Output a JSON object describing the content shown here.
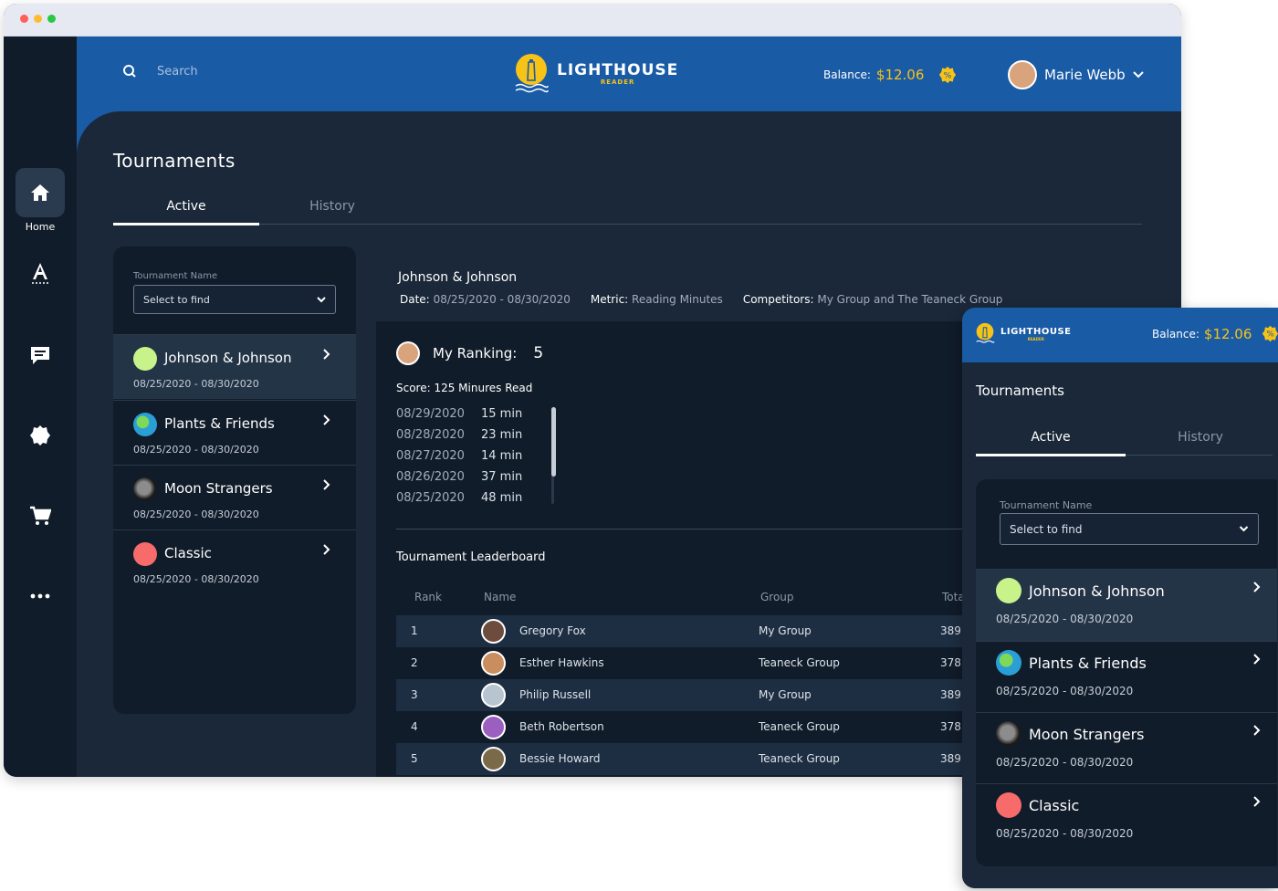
{
  "app": {
    "logo_title": "LIGHTHOUSE",
    "logo_subtitle": "READER",
    "search_placeholder": "Search",
    "balance_label": "Balance:",
    "balance_value": "$12.06",
    "user_name": "Marie Webb",
    "accent": "#1a5ba6",
    "gold": "#f7c316"
  },
  "sidebar": {
    "items": [
      {
        "label": "Home",
        "icon": "home-icon",
        "active": true
      },
      {
        "icon": "reading-icon"
      },
      {
        "icon": "messages-icon"
      },
      {
        "icon": "badge-icon"
      },
      {
        "icon": "cart-icon"
      },
      {
        "icon": "more-icon"
      }
    ]
  },
  "page": {
    "title": "Tournaments",
    "tabs": [
      {
        "label": "Active",
        "active": true
      },
      {
        "label": "History",
        "active": false
      }
    ]
  },
  "filter": {
    "label": "Tournament Name",
    "placeholder": "Select to find"
  },
  "tournaments": [
    {
      "name": "Johnson & Johnson",
      "dates": "08/25/2020 - 08/30/2020",
      "color": "#c8f28a",
      "selected": true
    },
    {
      "name": "Plants & Friends",
      "dates": "08/25/2020 - 08/30/2020",
      "color": "#2a9fd6",
      "selected": false
    },
    {
      "name": "Moon Strangers",
      "dates": "08/25/2020 - 08/30/2020",
      "color": "#3a3a3a",
      "selected": false
    },
    {
      "name": "Classic",
      "dates": "08/25/2020 - 08/30/2020",
      "color": "#f76b6b",
      "selected": false
    }
  ],
  "detail": {
    "title": "Johnson & Johnson",
    "date_key": "Date:",
    "date_value": "08/25/2020 - 08/30/2020",
    "metric_key": "Metric:",
    "metric_value": "Reading Minutes",
    "competitors_key": "Competitors:",
    "competitors_value": "My Group and The Teaneck Group",
    "ranking_label": "My Ranking:",
    "ranking_value": "5",
    "score": "Score: 125 Minures Read",
    "log": [
      {
        "date": "08/29/2020",
        "minutes": "15 min"
      },
      {
        "date": "08/28/2020",
        "minutes": "23 min"
      },
      {
        "date": "08/27/2020",
        "minutes": "14 min"
      },
      {
        "date": "08/26/2020",
        "minutes": "37 min"
      },
      {
        "date": "08/25/2020",
        "minutes": "48 min"
      }
    ],
    "leaderboard_title": "Tournament Leaderboard",
    "leaderboard_columns": [
      "Rank",
      "Name",
      "Group",
      "Tota"
    ],
    "leaderboard": [
      {
        "rank": "1",
        "name": "Gregory Fox",
        "group": "My Group",
        "total": "389"
      },
      {
        "rank": "2",
        "name": "Esther Hawkins",
        "group": "Teaneck Group",
        "total": "378"
      },
      {
        "rank": "3",
        "name": "Philip Russell",
        "group": "My Group",
        "total": "389"
      },
      {
        "rank": "4",
        "name": "Beth Robertson",
        "group": "Teaneck Group",
        "total": "378"
      },
      {
        "rank": "5",
        "name": "Bessie Howard",
        "group": "Teaneck Group",
        "total": "389"
      }
    ]
  }
}
